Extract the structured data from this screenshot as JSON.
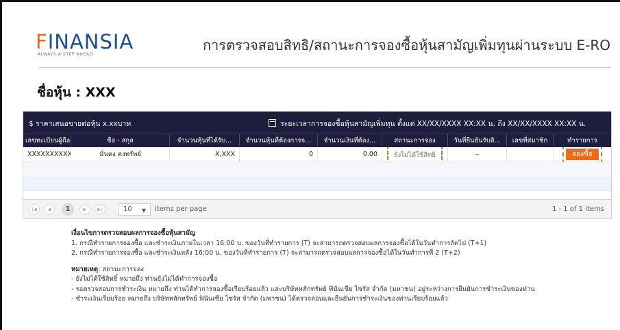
{
  "header": {
    "logo_main": "INANSIA",
    "logo_first_letter": "F",
    "logo_tagline": "ALWAYS A STEP AHEAD",
    "title": "การตรวจสอบสิทธิ/สถานะการจองซื้อหุ้นสามัญเพิ่มทุนผ่านระบบ E-RO"
  },
  "stock": {
    "label": "ชื่อหุ้น : XXX"
  },
  "banner": {
    "price": "$ ราคาเสนอขายต่อหุ้น x.xxบาท",
    "period": "ระยะเวลาการจองซื้อหุ้นสามัญเพิ่มทุน ตั้งแต่ XX/XX/XXXX XX:XX น. ถึง XX/XX/XXXX XX:XX น."
  },
  "table": {
    "headers": [
      "เลขทะเบียนผู้ถือ...",
      "ชื่อ - สกุล",
      "จำนวนหุ้นที่ได้รับ...",
      "จำนวนหุ้นที่ต้องการจ...",
      "จำนวนเงินที่ต้อง...",
      "สถานะการจอง",
      "วันที่ยืนยันรับสิ...",
      "เลขที่สมาชิก",
      "ทำรายการ"
    ],
    "row": {
      "holder_id": "XXXXXXXXXX",
      "name": "มั่นคง คงทรัพย์",
      "allocated": "X,XXX",
      "requested": "0",
      "amount": "0.00",
      "status": "ยังไม่ได้ใช้สิทธิ",
      "confirm_date": "–",
      "member_no": "",
      "action": "จองซื้อ"
    }
  },
  "pager": {
    "current_page": "1",
    "page_size": "10",
    "items_label": "items per page",
    "info": "1 - 1 of 1 items"
  },
  "notes": {
    "heading": "เงื่อนไขการตรวจสอบผลการจองซื้อหุ้นสามัญ",
    "items": [
      "1. กรณีทำรายการจองซื้อ และชำระเงินภายในเวลา 16:00 น. ของวันที่ทำรายการ (T) จะสามารถตรวจสอบผลการจองซื้อได้ในวันทำการถัดไป (T+1)",
      "2. กรณีทำรายการจองซื้อ และชำระเงินหลัง 16:00 น. ของวันที่ทำรายการ (T) จะสามารถตรวจสอบผลการจองซื้อได้ในวันทำการที่ 2 (T+2)"
    ],
    "remark_heading": "หมายเหตุ",
    "remark_suffix": ": สถานะการจอง",
    "remarks": [
      "- ยังไม่ได้ใช้สิทธิ์ หมายถึง ท่านยังไม่ได้ทำการจองซื้อ",
      "- รอตรวจสอบการชำระเงิน หมายถึง ท่านได้ทำการจองซื้อเรียบร้อยแล้ว และบริษัทหลักทรัพย์ ฟินันเซีย ไซรัส จำกัด (มหาชน) อยู่ระหว่างการยืนยันการชำระเงินของท่าน",
      "- ชำระเงินเรียบร้อย หมายถึง บริษัทหลักทรัพย์ ฟินันเซีย ไซรัส จำกัด (มหาชน) ได้ตรวจสอบและยืนยันการชำระเงินของท่านเรียบร้อยแล้ว"
    ]
  },
  "colors": {
    "accent": "#ee6b1c",
    "banner": "#1d1d3d",
    "brand_blue": "#1f4e8c"
  }
}
